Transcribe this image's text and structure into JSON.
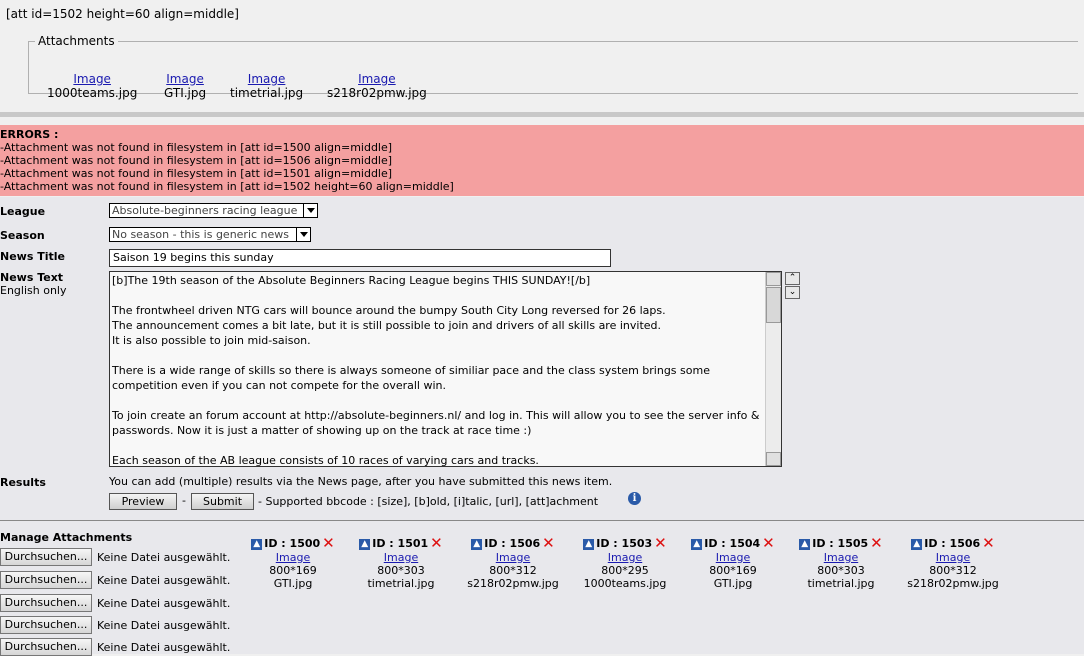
{
  "top": {
    "att_line": "[att id=1502 height=60 align=middle]"
  },
  "attachments_box": {
    "legend": "Attachments",
    "items": [
      {
        "link": "Image",
        "file": "1000teams.jpg"
      },
      {
        "link": "Image",
        "file": "GTI.jpg"
      },
      {
        "link": "Image",
        "file": "timetrial.jpg"
      },
      {
        "link": "Image",
        "file": "s218r02pmw.jpg"
      }
    ]
  },
  "errors": {
    "title": "ERRORS :",
    "lines": [
      "-Attachment was not found in filesystem in [att id=1500 align=middle]",
      "-Attachment was not found in filesystem in [att id=1506 align=middle]",
      "-Attachment was not found in filesystem in [att id=1501 align=middle]",
      "-Attachment was not found in filesystem in [att id=1502 height=60 align=middle]"
    ],
    "bg_color": "#f4a0a0"
  },
  "form": {
    "league_label": "League",
    "league_value": "Absolute-beginners racing league",
    "season_label": "Season",
    "season_value": "No season - this is generic news",
    "title_label": "News Title",
    "title_value": "Saison 19 begins this sunday",
    "text_label": "News Text",
    "text_sublabel": "English only",
    "text_lines": [
      "[b]The 19th season of the Absolute Beginners Racing League begins THIS SUNDAY![/b]",
      "",
      "The frontwheel driven NTG cars will bounce around the bumpy South City Long reversed for 26 laps.",
      "The announcement comes a bit late, but it is still possible to join and drivers of all skills are invited.",
      "It is also possible to join mid-saison.",
      "",
      "There is a wide range of skills so there is always someone of similiar pace and the class system brings some",
      "competition even if you can not compete for the overall win.",
      "",
      "To join create an forum account at http://absolute-beginners.nl/ and log in. This will allow you to see the server info &",
      "passwords. Now it is just a matter of showing up on the track at race time :)",
      "",
      "Each season of the AB league consists of 10 races of varying cars and tracks."
    ],
    "results_label": "Results",
    "results_text": "You can add (multiple) results via the News page, after you have submitted this news item.",
    "preview_label": "Preview",
    "dash": "-",
    "submit_label": "Submit",
    "bbcode_text": "- Supported bbcode : [size], [b]old, [i]talic, [url], [att]achment"
  },
  "manage": {
    "title": "Manage Attachments",
    "browse_label": "Durchsuchen...",
    "no_file_text": "Keine Datei ausgewählt.",
    "rows": 5,
    "cards": [
      {
        "id_label": "ID :",
        "id": "1500",
        "link": "Image",
        "dims": "800*169",
        "file": "GTI.jpg"
      },
      {
        "id_label": "ID :",
        "id": "1501",
        "link": "Image",
        "dims": "800*303",
        "file": "timetrial.jpg"
      },
      {
        "id_label": "ID :",
        "id": "1506",
        "link": "Image",
        "dims": "800*312",
        "file": "s218r02pmw.jpg"
      },
      {
        "id_label": "ID :",
        "id": "1503",
        "link": "Image",
        "dims": "800*295",
        "file": "1000teams.jpg"
      },
      {
        "id_label": "ID :",
        "id": "1504",
        "link": "Image",
        "dims": "800*169",
        "file": "GTI.jpg"
      },
      {
        "id_label": "ID :",
        "id": "1505",
        "link": "Image",
        "dims": "800*303",
        "file": "timetrial.jpg"
      },
      {
        "id_label": "ID :",
        "id": "1506",
        "link": "Image",
        "dims": "800*312",
        "file": "s218r02pmw.jpg"
      }
    ]
  },
  "icons": {
    "up": "up-arrow-icon",
    "delete": "delete-x-icon",
    "info": "info-icon"
  }
}
